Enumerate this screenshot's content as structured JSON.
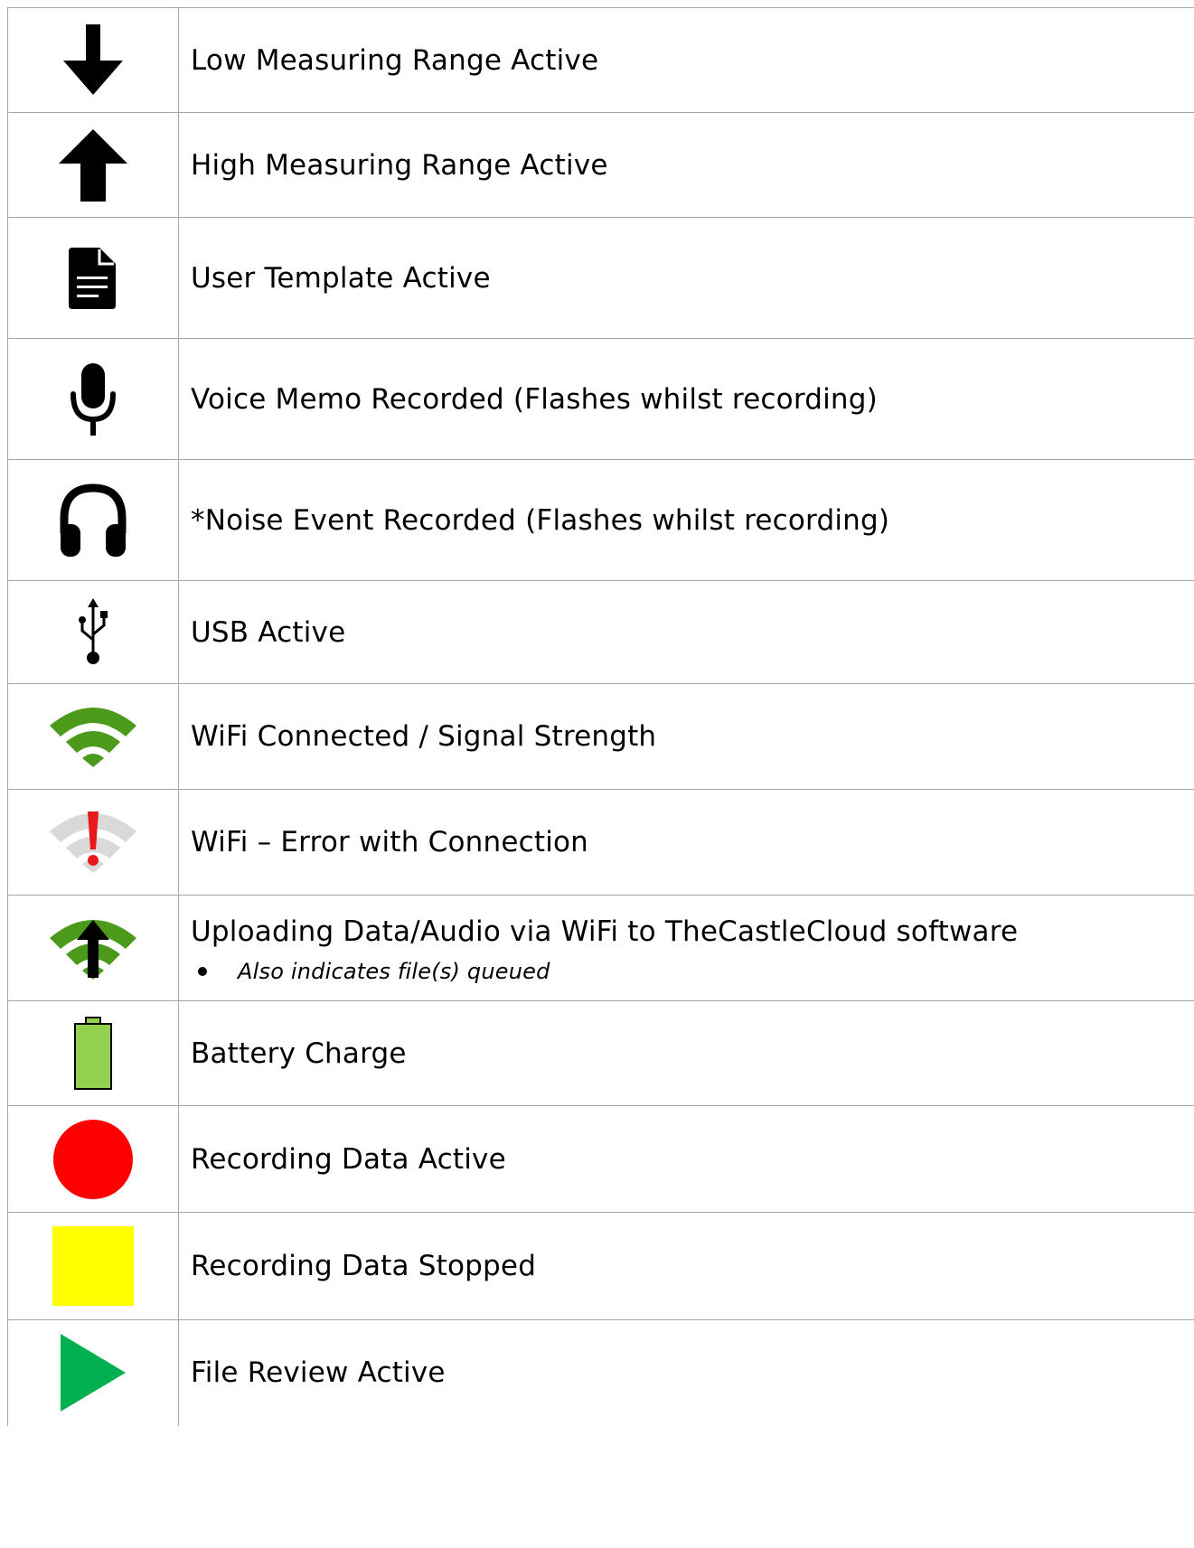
{
  "rows": [
    {
      "icon": "arrow-down-icon",
      "label": "Low Measuring Range Active"
    },
    {
      "icon": "arrow-up-icon",
      "label": "High Measuring Range Active"
    },
    {
      "icon": "document-icon",
      "label": "User Template Active"
    },
    {
      "icon": "microphone-icon",
      "label": "Voice Memo Recorded (Flashes whilst recording)"
    },
    {
      "icon": "headphones-icon",
      "label": "*Noise Event Recorded (Flashes whilst recording)"
    },
    {
      "icon": "usb-icon",
      "label": "USB Active"
    },
    {
      "icon": "wifi-icon",
      "label": "WiFi Connected / Signal Strength"
    },
    {
      "icon": "wifi-error-icon",
      "label": "WiFi – Error with Connection"
    },
    {
      "icon": "wifi-upload-icon",
      "label": "Uploading Data/Audio via WiFi to TheCastleCloud software",
      "note": "Also indicates file(s) queued"
    },
    {
      "icon": "battery-icon",
      "label": "Battery Charge"
    },
    {
      "icon": "record-circle-icon",
      "label": "Recording Data Active"
    },
    {
      "icon": "stop-square-icon",
      "label": "Recording Data Stopped"
    },
    {
      "icon": "play-triangle-icon",
      "label": "File Review Active"
    }
  ],
  "colors": {
    "border": "#a6a6a6",
    "wifi_green": "#4c9a1c",
    "wifi_grey": "#d9d9d9",
    "error_red": "#e8191c",
    "battery_green": "#92d050",
    "record_red": "#ff0000",
    "stop_yellow": "#ffff00",
    "play_green": "#00b050"
  }
}
